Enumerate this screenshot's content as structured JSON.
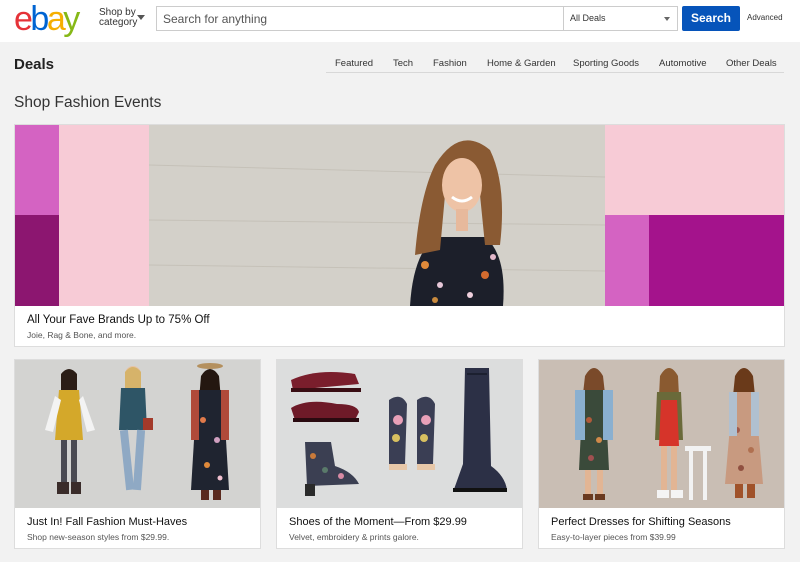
{
  "header": {
    "logo_letters": [
      "e",
      "b",
      "a",
      "y"
    ],
    "logo_colors": [
      "#e53238",
      "#0064d2",
      "#f5af02",
      "#86b817"
    ],
    "shop_by_line1": "Shop by",
    "shop_by_line2": "category",
    "search_placeholder": "Search for anything",
    "category_selected": "All Deals",
    "search_button": "Search",
    "advanced_link": "Advanced"
  },
  "deals": {
    "title": "Deals",
    "nav": [
      "Featured",
      "Tech",
      "Fashion",
      "Home & Garden",
      "Sporting Goods",
      "Automotive",
      "Other Deals"
    ]
  },
  "section": {
    "title": "Shop Fashion Events"
  },
  "hero": {
    "title": "All Your Fave Brands Up to 75% Off",
    "subtitle": "Joie, Rag & Bone, and more."
  },
  "cards": [
    {
      "title": "Just In! Fall Fashion Must-Haves",
      "subtitle": "Shop new-season styles from $29.99."
    },
    {
      "title": "Shoes of the Moment—From $29.99",
      "subtitle": "Velvet, embroidery & prints galore."
    },
    {
      "title": "Perfect Dresses for Shifting Seasons",
      "subtitle": "Easy-to-layer pieces from $39.99"
    }
  ],
  "colors": {
    "accent_blue": "#0654ba",
    "hero_pink_light": "#f7cbd6",
    "hero_magenta": "#d463c2",
    "hero_plum": "#8c1670",
    "hero_purple": "#a4138c"
  }
}
